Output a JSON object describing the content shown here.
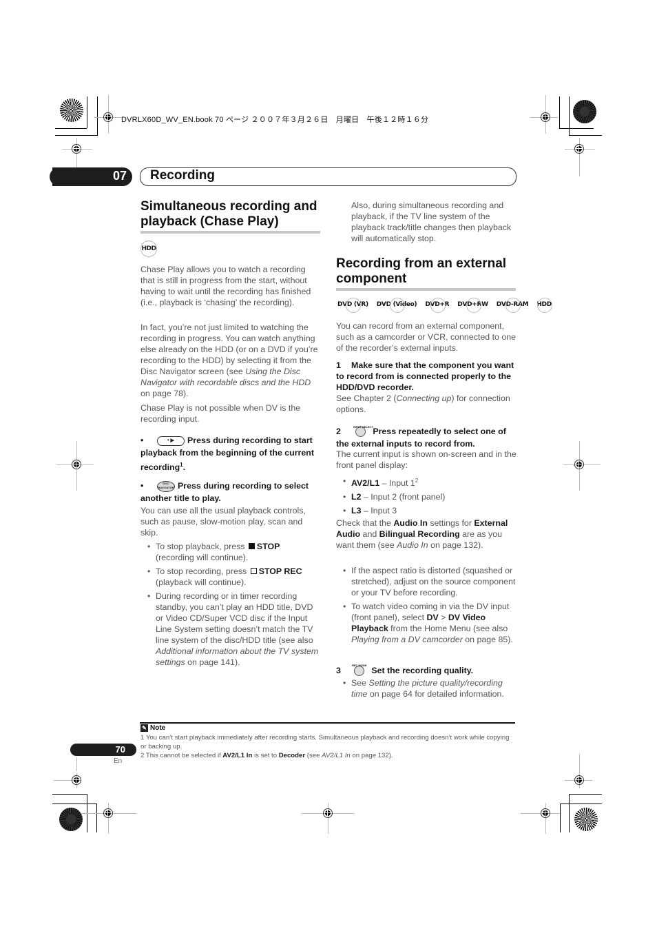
{
  "print_header": "DVRLX60D_WV_EN.book  70 ページ  ２００７年３月２６日　月曜日　午後１２時１６分",
  "chapter": {
    "number": "07",
    "title": "Recording"
  },
  "left": {
    "section_title_line1": "Simultaneous recording and",
    "section_title_line2": "playback (Chase Play)",
    "badge": "HDD",
    "para1": "Chase Play allows you to watch a recording that is still in progress from the start, without having to wait until the recording has finished (i.e., playback is ‘chasing’ the recording).",
    "para2_a": "In fact, you’re not just limited to watching the recording in progress. You can watch anything else already on the HDD (or on a DVD if you’re recording to the HDD) by selecting it from the Disc Navigator screen (see ",
    "para2_italic": "Using the Disc Navigator with recordable discs and the HDD",
    "para2_b": " on page 78).",
    "para3": "Chase Play is not possible when DV is the recording input.",
    "bullet1_button": "• ▶",
    "bullet1_text": "Press during recording to start playback from the beginning of the current recording",
    "bullet1_sup": "1",
    "bullet2_button": "DISC NAVIGATOR",
    "bullet2_text": "Press during recording to select another title to play.",
    "para4": "You can use all the usual playback controls, such as pause, slow-motion play, scan and skip.",
    "sub_items": [
      {
        "pre": "To stop playback, press ",
        "bold": "STOP",
        "post": " (recording will continue)."
      },
      {
        "pre": "To stop recording, press ",
        "bold": "STOP REC",
        "post": " (playback will continue)."
      },
      {
        "pre": "During recording or in timer recording standby, you can’t play an HDD title, DVD or Video CD/Super VCD disc if the Input Line System setting doesn’t match the TV line system of the disc/HDD title (see also ",
        "italic": "Additional information about the TV system settings",
        "post": " on page 141)."
      }
    ]
  },
  "right": {
    "continued_para": "Also, during simultaneous recording and playback, if the TV line system of the playback track/title changes then playback will automatically stop.",
    "section_title_line1": "Recording from an external",
    "section_title_line2": "component",
    "badges": [
      "DVD (VR)",
      "DVD (Video)",
      "DVD+R",
      "DVD+RW",
      "DVD-RAM",
      "HDD"
    ],
    "intro": "You can record from an external component, such as a camcorder or VCR, connected to one of the recorder’s external inputs.",
    "step1_num": "1",
    "step1_title": "Make sure that the component you want to record from is connected properly to the HDD/DVD recorder.",
    "step1_pre": "See Chapter 2 (",
    "step1_italic": "Connecting up",
    "step1_post": ") for connection options.",
    "step2_num": "2",
    "step2_button": "INPUT SELECT",
    "step2_title": "Press repeatedly to select one of the external inputs to record from.",
    "step2_body": "The current input is shown on-screen and in the front panel display:",
    "inputs": [
      {
        "bold": "AV2/L1",
        "text": " – Input 1",
        "sup": "2"
      },
      {
        "bold": "L2",
        "text": " – Input 2 (front panel)",
        "sup": ""
      },
      {
        "bold": "L3",
        "text": " – Input 3",
        "sup": ""
      }
    ],
    "check_pre": "Check that the ",
    "check_b1": "Audio In",
    "check_mid1": " settings for ",
    "check_b2": "External Audio",
    "check_mid2": " and ",
    "check_b3": "Bilingual Recording",
    "check_mid3": " are as you want them (see ",
    "check_it": "Audio In",
    "check_post": " on page 132).",
    "tip1": "If the aspect ratio is distorted (squashed or stretched), adjust on the source component or your TV before recording.",
    "tip2_pre": "To watch video coming in via the DV input (front panel), select ",
    "tip2_b1": "DV",
    "tip2_gt": " > ",
    "tip2_b2": "DV Video Playback",
    "tip2_mid": " from the Home Menu (see also ",
    "tip2_it": "Playing from a DV camcorder",
    "tip2_post": " on page 85).",
    "step3_num": "3",
    "step3_button": "REC MODE",
    "step3_title": "Set the recording quality.",
    "step3_pre": "See ",
    "step3_it": "Setting the picture quality/recording time",
    "step3_post": " on page 64 for detailed information."
  },
  "note": {
    "title": "Note",
    "n1": "1 You can’t start playback immediately after recording starts. Simultaneous playback and recording doesn’t work while copying or backing up.",
    "n2_pre": "2 This cannot be selected if ",
    "n2_b1": "AV2/L1 In",
    "n2_mid": " is set to ",
    "n2_b2": "Decoder",
    "n2_mid2": " (see ",
    "n2_it": "AV2/L1 In",
    "n2_post": " on page 132)."
  },
  "footer": {
    "page": "70",
    "lang": "En"
  }
}
